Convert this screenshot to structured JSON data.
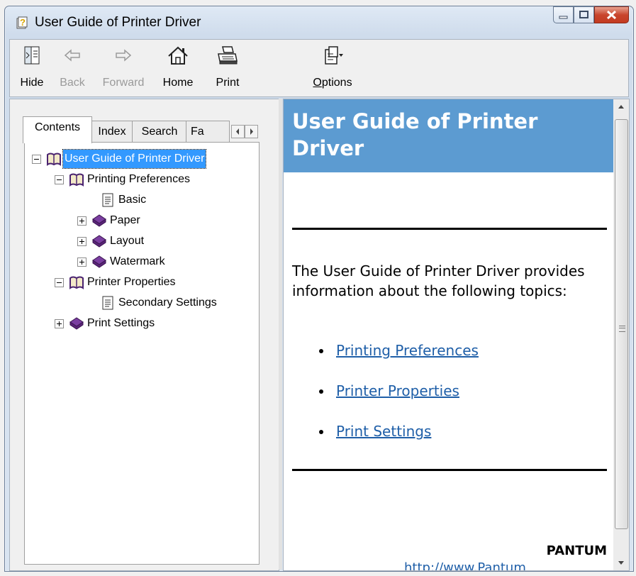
{
  "window": {
    "title": "User Guide of Printer Driver",
    "colors": {
      "title_bar": "#cfdcec",
      "close_button": "#c8462d"
    }
  },
  "toolbar": {
    "hide_label": "Hide",
    "back_label": "Back",
    "forward_label": "Forward",
    "home_label": "Home",
    "print_label": "Print",
    "options_label": "Options"
  },
  "tabs": {
    "contents": "Contents",
    "index": "Index",
    "search": "Search",
    "favorites": "Fa"
  },
  "tree": {
    "items": [
      {
        "label": "User Guide of Printer Driver",
        "icon": "book-open-icon",
        "expanded": true,
        "selected": true
      },
      {
        "label": "Printing Preferences",
        "icon": "book-open-icon",
        "expanded": true
      },
      {
        "label": "Basic",
        "icon": "page-icon"
      },
      {
        "label": "Paper",
        "icon": "book-closed-icon",
        "expanded": false
      },
      {
        "label": "Layout",
        "icon": "book-closed-icon",
        "expanded": false
      },
      {
        "label": "Watermark",
        "icon": "book-closed-icon",
        "expanded": false
      },
      {
        "label": "Printer Properties",
        "icon": "book-open-icon",
        "expanded": true
      },
      {
        "label": "Secondary Settings",
        "icon": "page-icon"
      },
      {
        "label": "Print Settings",
        "icon": "book-closed-icon",
        "expanded": false
      }
    ]
  },
  "content": {
    "title": "User Guide of Printer Driver",
    "intro": "The User Guide of Printer Driver provides information about the following topics:",
    "links": [
      "Printing Preferences",
      "Printer Properties",
      "Print Settings"
    ],
    "brand": "PANTUM",
    "footer_link": "http://www.Pantum",
    "colors": {
      "banner": "#5c9bd1",
      "link": "#1f5fa8"
    }
  }
}
